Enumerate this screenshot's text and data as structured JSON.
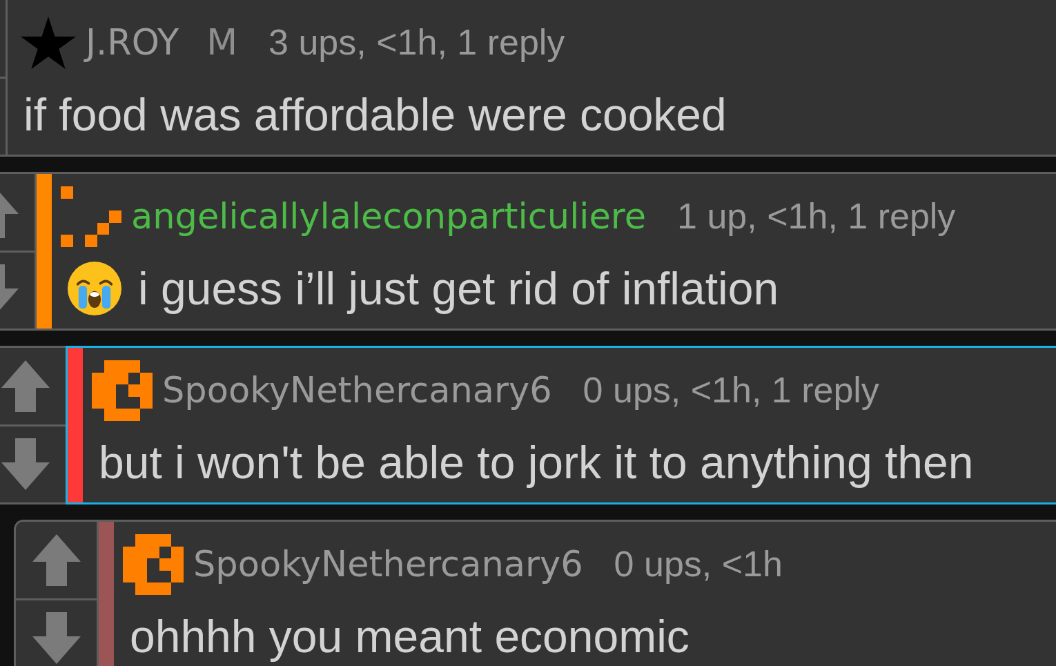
{
  "comments": [
    {
      "user": {
        "name": "J.ROY",
        "color": "#9a9a9a"
      },
      "badge": "M",
      "avatar": {
        "kind": "star"
      },
      "meta": "3 ups, <1h, 1 reply",
      "highlighted": false,
      "text": "if food was affordable were cooked",
      "children": [
        {
          "user": {
            "name": "angelicallylaleconparticuliere",
            "color": "#4cbb47"
          },
          "avatar": {
            "kind": "pixel-sparse"
          },
          "color": "#ff8800",
          "meta": "1 up, <1h, 1 reply",
          "highlighted": false,
          "emoji": {
            "kind": "crying"
          },
          "text": "i guess i’ll just get rid of inflation",
          "children": [
            {
              "user": {
                "name": "SpookyNethercanary6",
                "color": "#9a9a9a"
              },
              "avatar": {
                "kind": "pixel-ring"
              },
              "color": "#ff3838",
              "meta": "0 ups, <1h, 1 reply",
              "highlighted": true,
              "text": "but i won't be able to jork it to anything then",
              "children": [
                {
                  "user": {
                    "name": "SpookyNethercanary6",
                    "color": "#9a9a9a"
                  },
                  "avatar": {
                    "kind": "pixel-ring"
                  },
                  "color": "#9b5555",
                  "meta": "0 ups, <1h",
                  "highlighted": false,
                  "text": "ohhhh you meant economic"
                }
              ]
            }
          ]
        }
      ]
    }
  ]
}
